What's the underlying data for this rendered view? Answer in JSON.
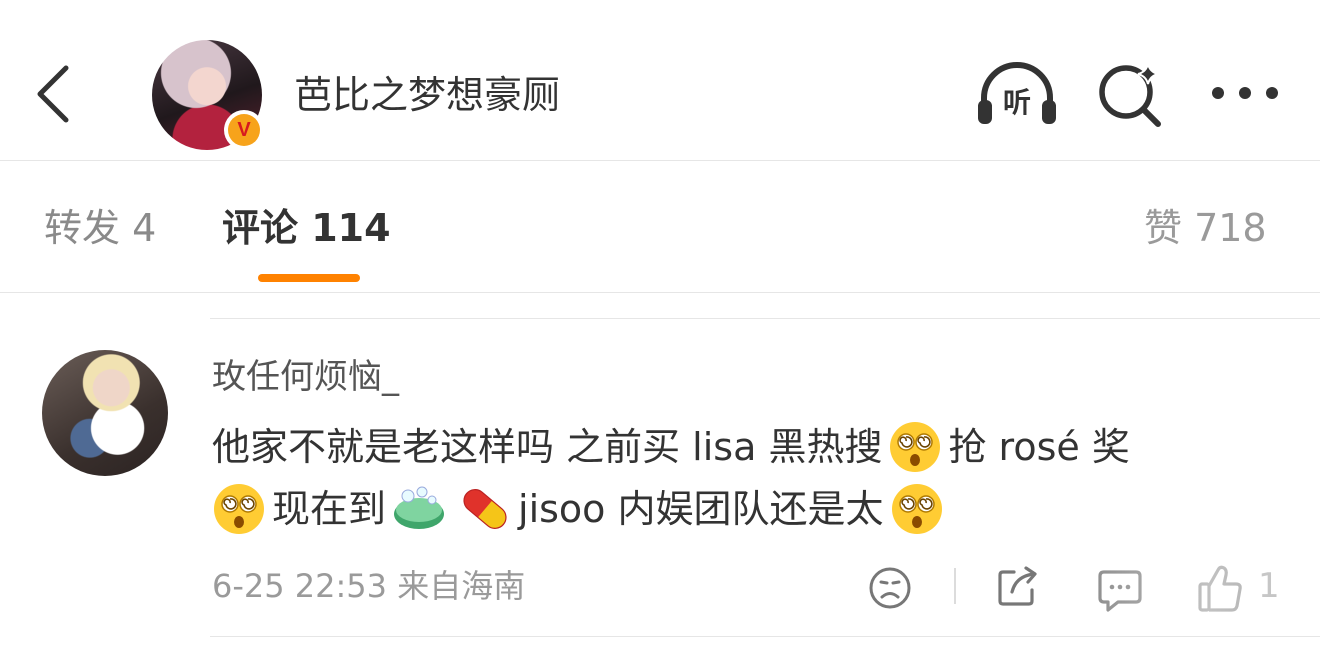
{
  "header": {
    "title": "芭比之梦想豪厕",
    "verified_badge": "V",
    "listen_label": "听",
    "icons": [
      "back-icon",
      "listen-icon",
      "search-icon",
      "more-icon"
    ]
  },
  "tabs": {
    "repost": "转发 4",
    "comments": "评论 114",
    "likes": "赞 718",
    "active": "comments",
    "accent_color": "#ff8200"
  },
  "comment": {
    "username": "玫任何烦恼_",
    "line1": {
      "part1": "他家不就是老这样吗  之前买 lisa 黑热搜",
      "part2": "  抢 rosé 奖"
    },
    "line2": {
      "part1": "  现在到",
      "part2": "jisoo 内娱团队还是太"
    },
    "emojis": [
      "dizzy-face-emoji",
      "soap-emoji",
      "pill-emoji"
    ],
    "meta": "6-25 22:53  来自海南",
    "like_count": "1"
  }
}
